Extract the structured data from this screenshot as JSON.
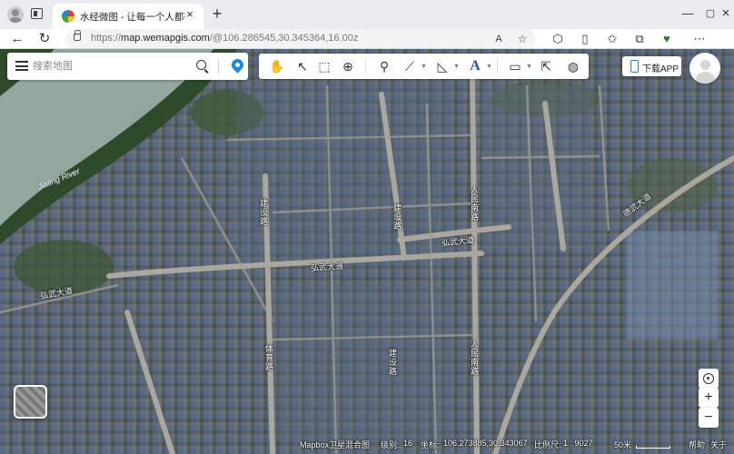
{
  "browser": {
    "tab_title": "水经微图 - 让每一个人都有自己的",
    "url_prefix": "https://",
    "url_host": "map.wemapgis.com",
    "url_path": "/@106.286545,30.345364,16.00z",
    "new_tab": "+",
    "close": "×"
  },
  "map_ui": {
    "search_placeholder": "搜索地图",
    "download_label": "下载APP"
  },
  "map_labels": {
    "river": "Jialing River",
    "road_1": "建设路",
    "road_2": "人民南路",
    "road_3": "弘武大道",
    "road_4": "弘武大道",
    "road_5": "弘武大道",
    "road_6": "体育路",
    "road_7": "建设路",
    "road_8": "人民南路",
    "road_9": "德武大道",
    "road_10": "建设路"
  },
  "status": {
    "map_source": "Mapbox卫星混合图",
    "zoom_label": "级别:",
    "zoom": "16",
    "coord_label": "坐标:",
    "coord": "106.273885,30.343067",
    "scale_label": "比例尺:",
    "scale": "1 : 9027",
    "scale_bar": "50米",
    "help": "帮助",
    "about": "关于"
  }
}
